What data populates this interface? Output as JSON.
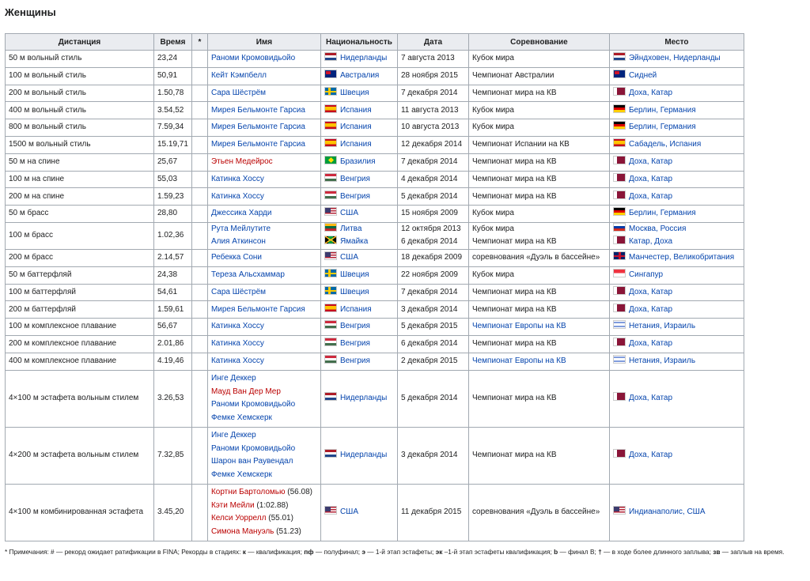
{
  "heading": "Женщины",
  "columns": [
    "Дистанция",
    "Время",
    "*",
    "Имя",
    "Национальность",
    "Дата",
    "Соревнование",
    "Место"
  ],
  "rows": [
    {
      "event": "50 м вольный стиль",
      "time": "23,24",
      "names": [
        {
          "t": "Раноми Кромовидьойо",
          "red": false
        }
      ],
      "flag": "nl",
      "nation": "Нидерланды",
      "dates": [
        "7 августа 2013"
      ],
      "comps": [
        {
          "t": "Кубок мира",
          "link": false
        }
      ],
      "vflag": "nl",
      "venue": "Эйндховен, Нидерланды"
    },
    {
      "event": "100 м вольный стиль",
      "time": "50,91",
      "names": [
        {
          "t": "Кейт Кэмпбелл",
          "red": false
        }
      ],
      "flag": "au",
      "nation": "Австралия",
      "dates": [
        "28 ноября 2015"
      ],
      "comps": [
        {
          "t": "Чемпионат Австралии",
          "link": false
        }
      ],
      "vflag": "au",
      "venue": "Сидней"
    },
    {
      "event": "200 м вольный стиль",
      "time": "1.50,78",
      "names": [
        {
          "t": "Сара Шёстрём",
          "red": false
        }
      ],
      "flag": "se",
      "nation": "Швеция",
      "dates": [
        "7 декабря 2014"
      ],
      "comps": [
        {
          "t": "Чемпионат мира на КВ",
          "link": false
        }
      ],
      "vflag": "qa",
      "venue": "Доха, Катар"
    },
    {
      "event": "400 м вольный стиль",
      "time": "3.54,52",
      "names": [
        {
          "t": "Мирея Бельмонте Гарсиа",
          "red": false
        }
      ],
      "flag": "es",
      "nation": "Испания",
      "dates": [
        "11 августа 2013"
      ],
      "comps": [
        {
          "t": "Кубок мира",
          "link": false
        }
      ],
      "vflag": "de",
      "venue": "Берлин, Германия"
    },
    {
      "event": "800 м вольный стиль",
      "time": "7.59,34",
      "names": [
        {
          "t": "Мирея Бельмонте Гарсиа",
          "red": false
        }
      ],
      "flag": "es",
      "nation": "Испания",
      "dates": [
        "10 августа 2013"
      ],
      "comps": [
        {
          "t": "Кубок мира",
          "link": false
        }
      ],
      "vflag": "de",
      "venue": "Берлин, Германия"
    },
    {
      "event": "1500 м вольный стиль",
      "time": "15.19,71",
      "names": [
        {
          "t": "Мирея Бельмонте Гарсиа",
          "red": false
        }
      ],
      "flag": "es",
      "nation": "Испания",
      "dates": [
        "12 декабря 2014"
      ],
      "comps": [
        {
          "t": "Чемпионат Испании на КВ",
          "link": false
        }
      ],
      "vflag": "es",
      "venue": "Сабадель, Испания"
    },
    {
      "event": "50 м на спине",
      "time": "25,67",
      "names": [
        {
          "t": "Этьен Медейрос",
          "red": true
        }
      ],
      "flag": "br",
      "nation": "Бразилия",
      "dates": [
        "7 декабря 2014"
      ],
      "comps": [
        {
          "t": "Чемпионат мира на КВ",
          "link": false
        }
      ],
      "vflag": "qa",
      "venue": "Доха, Катар"
    },
    {
      "event": "100 м на спине",
      "time": "55,03",
      "names": [
        {
          "t": "Катинка Хоссу",
          "red": false
        }
      ],
      "flag": "hu",
      "nation": "Венгрия",
      "dates": [
        "4 декабря 2014"
      ],
      "comps": [
        {
          "t": "Чемпионат мира на КВ",
          "link": false
        }
      ],
      "vflag": "qa",
      "venue": "Доха, Катар"
    },
    {
      "event": "200 м на спине",
      "time": "1.59,23",
      "names": [
        {
          "t": "Катинка Хоссу",
          "red": false
        }
      ],
      "flag": "hu",
      "nation": "Венгрия",
      "dates": [
        "5 декабря 2014"
      ],
      "comps": [
        {
          "t": "Чемпионат мира на КВ",
          "link": false
        }
      ],
      "vflag": "qa",
      "venue": "Доха, Катар"
    },
    {
      "event": "50 м брасс",
      "time": "28,80",
      "names": [
        {
          "t": "Джессика Харди",
          "red": false
        }
      ],
      "flag": "us",
      "nation": "США",
      "dates": [
        "15 ноября 2009"
      ],
      "comps": [
        {
          "t": "Кубок мира",
          "link": false
        }
      ],
      "vflag": "de",
      "venue": "Берлин, Германия"
    },
    {
      "event": "100 м брасс",
      "time": "1.02,36",
      "names": [
        {
          "t": "Рута Мейлутите",
          "red": false
        },
        {
          "t": "Алия Аткинсон",
          "red": false
        }
      ],
      "flag": "lt",
      "nation": "Литва",
      "flag2": "jm",
      "nation2": "Ямайка",
      "dates": [
        "12 октября 2013",
        "6 декабря 2014"
      ],
      "comps": [
        {
          "t": "Кубок мира",
          "link": false
        },
        {
          "t": "Чемпионат мира на КВ",
          "link": false
        }
      ],
      "vflag": "ru",
      "venue": "Москва, Россия",
      "vflag2": "qa",
      "venue2": "Катар, Доха"
    },
    {
      "event": "200 м брасс",
      "time": "2.14,57",
      "names": [
        {
          "t": "Ребекка Сони",
          "red": false
        }
      ],
      "flag": "us",
      "nation": "США",
      "dates": [
        "18 декабря 2009"
      ],
      "comps": [
        {
          "t": "соревнования «Дуэль в бассейне»",
          "link": false
        }
      ],
      "vflag": "gb",
      "venue": "Манчестер, Великобритания"
    },
    {
      "event": "50 м баттерфляй",
      "time": "24,38",
      "names": [
        {
          "t": "Тереза Альсхаммар",
          "red": false
        }
      ],
      "flag": "se",
      "nation": "Швеция",
      "dates": [
        "22 ноября 2009"
      ],
      "comps": [
        {
          "t": "Кубок мира",
          "link": false
        }
      ],
      "vflag": "sg",
      "venue": "Сингапур"
    },
    {
      "event": "100 м баттерфляй",
      "time": "54,61",
      "names": [
        {
          "t": "Сара Шёстрём",
          "red": false
        }
      ],
      "flag": "se",
      "nation": "Швеция",
      "dates": [
        "7 декабря 2014"
      ],
      "comps": [
        {
          "t": "Чемпионат мира на КВ",
          "link": false
        }
      ],
      "vflag": "qa",
      "venue": "Доха, Катар"
    },
    {
      "event": "200 м баттерфляй",
      "time": "1.59,61",
      "names": [
        {
          "t": "Мирея Бельмонте Гарсия",
          "red": false
        }
      ],
      "flag": "es",
      "nation": "Испания",
      "dates": [
        "3 декабря 2014"
      ],
      "comps": [
        {
          "t": "Чемпионат мира на КВ",
          "link": false
        }
      ],
      "vflag": "qa",
      "venue": "Доха, Катар"
    },
    {
      "event": "100 м комплексное плавание",
      "time": "56,67",
      "names": [
        {
          "t": "Катинка Хоссу",
          "red": false
        }
      ],
      "flag": "hu",
      "nation": "Венгрия",
      "dates": [
        "5 декабря 2015"
      ],
      "comps": [
        {
          "t": "Чемпионат Европы на КВ",
          "link": true
        }
      ],
      "vflag": "il",
      "venue": "Нетания, Израиль"
    },
    {
      "event": "200 м комплексное плавание",
      "time": "2.01,86",
      "names": [
        {
          "t": "Катинка Хоссу",
          "red": false
        }
      ],
      "flag": "hu",
      "nation": "Венгрия",
      "dates": [
        "6 декабря 2014"
      ],
      "comps": [
        {
          "t": "Чемпионат мира на КВ",
          "link": false
        }
      ],
      "vflag": "qa",
      "venue": "Доха, Катар"
    },
    {
      "event": "400 м комплексное плавание",
      "time": "4.19,46",
      "names": [
        {
          "t": "Катинка Хоссу",
          "red": false
        }
      ],
      "flag": "hu",
      "nation": "Венгрия",
      "dates": [
        "2 декабря 2015"
      ],
      "comps": [
        {
          "t": "Чемпионат Европы на КВ",
          "link": true
        }
      ],
      "vflag": "il",
      "venue": "Нетания, Израиль"
    },
    {
      "event": "4×100 м эстафета вольным стилем",
      "time": "3.26,53",
      "names": [
        {
          "t": "Инге Деккер",
          "red": false
        },
        {
          "t": "Мауд Ван Дер Мер",
          "red": true
        },
        {
          "t": "Раноми Кромовидьойо",
          "red": false
        },
        {
          "t": "Фемке Хемскерк",
          "red": false
        }
      ],
      "flag": "nl",
      "nation": "Нидерланды",
      "dates": [
        "5 декабря 2014"
      ],
      "comps": [
        {
          "t": "Чемпионат мира на КВ",
          "link": false
        }
      ],
      "vflag": "qa",
      "venue": "Доха, Катар"
    },
    {
      "event": "4×200 м эстафета вольным стилем",
      "time": "7.32,85",
      "names": [
        {
          "t": "Инге Деккер",
          "red": false
        },
        {
          "t": "Раноми Кромовидьойо",
          "red": false
        },
        {
          "t": "Шарон ван Раувендал",
          "red": false
        },
        {
          "t": "Фемке Хемскерк",
          "red": false
        }
      ],
      "flag": "nl",
      "nation": "Нидерланды",
      "dates": [
        "3 декабря 2014"
      ],
      "comps": [
        {
          "t": "Чемпионат мира на КВ",
          "link": false
        }
      ],
      "vflag": "qa",
      "venue": "Доха, Катар"
    },
    {
      "event": "4×100 м комбинированная эстафета",
      "time": "3.45,20",
      "names": [
        {
          "t": "Кортни Бартоломью",
          "red": true,
          "extra": " (56.08)"
        },
        {
          "t": "Кэти Мейли",
          "red": true,
          "extra": " (1:02.88)"
        },
        {
          "t": "Келси Уоррелл",
          "red": true,
          "extra": " (55.01)"
        },
        {
          "t": "Симона Мануэль",
          "red": true,
          "extra": " (51.23)"
        }
      ],
      "flag": "us",
      "nation": "США",
      "dates": [
        "11 декабря 2015"
      ],
      "comps": [
        {
          "t": "соревнования «Дуэль в бассейне»",
          "link": false
        }
      ],
      "vflag": "us",
      "venue": "Индианаполис, США"
    }
  ],
  "notes": {
    "star": "*",
    "text": " Примечания: # — рекорд ожидает ратификации в FINA; Рекорды в стадиях: ",
    "k": "к",
    "k_text": " — квалификация; ",
    "pf": "пф",
    "pf_text": " — полуфинал; ",
    "e": "э",
    "e_text": " — 1-й этап эстафеты; ",
    "ek": "эк",
    "ek_text": " –1-й этап эстафеты квалификация; ",
    "b": "b",
    "b_text": " — финал B; ",
    "dag": "†",
    "dag_text": " — в ходе более длинного заплыва; ",
    "zv": "зв",
    "zv_text": " — заплыв на время."
  }
}
